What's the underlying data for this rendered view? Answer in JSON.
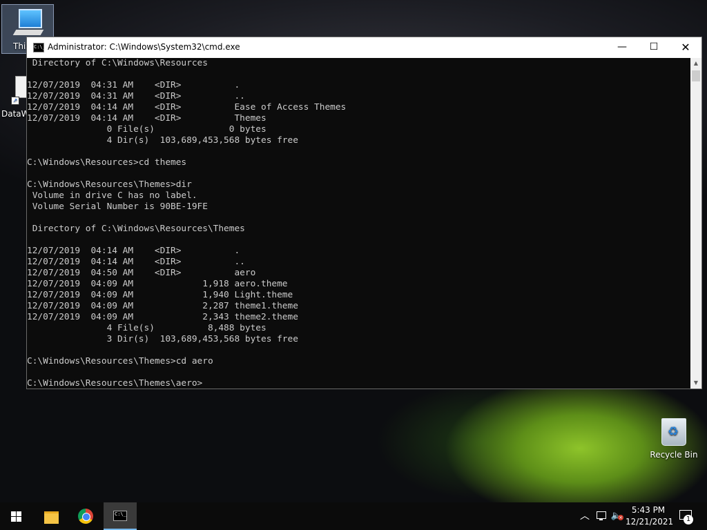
{
  "desktop": {
    "icons": [
      {
        "label": "This"
      },
      {
        "label": "DataW"
      },
      {
        "label": "Recycle Bin"
      }
    ]
  },
  "window": {
    "title": "Administrator: C:\\Windows\\System32\\cmd.exe",
    "app_icon_text": "C:\\_",
    "controls": {
      "minimize": "—",
      "maximize": "☐",
      "close": "✕"
    }
  },
  "console": {
    "lines": [
      " Directory of C:\\Windows\\Resources",
      "",
      "12/07/2019  04:31 AM    <DIR>          .",
      "12/07/2019  04:31 AM    <DIR>          ..",
      "12/07/2019  04:14 AM    <DIR>          Ease of Access Themes",
      "12/07/2019  04:14 AM    <DIR>          Themes",
      "               0 File(s)              0 bytes",
      "               4 Dir(s)  103,689,453,568 bytes free",
      "",
      "C:\\Windows\\Resources>cd themes",
      "",
      "C:\\Windows\\Resources\\Themes>dir",
      " Volume in drive C has no label.",
      " Volume Serial Number is 90BE-19FE",
      "",
      " Directory of C:\\Windows\\Resources\\Themes",
      "",
      "12/07/2019  04:14 AM    <DIR>          .",
      "12/07/2019  04:14 AM    <DIR>          ..",
      "12/07/2019  04:50 AM    <DIR>          aero",
      "12/07/2019  04:09 AM             1,918 aero.theme",
      "12/07/2019  04:09 AM             1,940 Light.theme",
      "12/07/2019  04:09 AM             2,287 theme1.theme",
      "12/07/2019  04:09 AM             2,343 theme2.theme",
      "               4 File(s)          8,488 bytes",
      "               3 Dir(s)  103,689,453,568 bytes free",
      "",
      "C:\\Windows\\Resources\\Themes>cd aero",
      "",
      "C:\\Windows\\Resources\\Themes\\aero>"
    ]
  },
  "scrollbar": {
    "up": "▲",
    "down": "▼"
  },
  "taskbar": {
    "items": [
      "start-icon",
      "file-explorer-icon",
      "chrome-icon",
      "cmd-icon"
    ],
    "tray": {
      "chevron": "︿",
      "volume_glyph": "🔈",
      "volume_muted_mark": "×",
      "time": "5:43 PM",
      "date": "12/21/2021",
      "notification_count": "1"
    }
  },
  "colors": {
    "console_bg": "#0c0c0c",
    "console_fg": "#cccccc",
    "taskbar_bg": "#0b0b0b",
    "titlebar_bg": "#ffffff",
    "active_indicator": "#76b9ed"
  }
}
